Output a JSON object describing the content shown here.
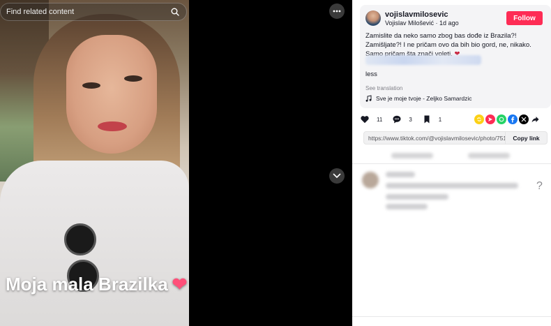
{
  "search": {
    "placeholder": "Find related content",
    "icon": "search-icon"
  },
  "photo": {
    "caption_text": "Moja mala Brazilka",
    "caption_emoji": "❤"
  },
  "post": {
    "username": "vojislavmilosevic",
    "display_name": "Vojislav Milošević",
    "time_ago": "1d ago",
    "follow_label": "Follow",
    "description": "Zamislite da neko samo zbog bas dođe iz Brazila?! Zamišljate?! I ne pričam ovo da bih bio gord, ne, nikako. Samo pričam šta znači voleti.",
    "description_emoji": "❤",
    "less_label": "less",
    "see_translation": "See translation",
    "music": "Sve je moje tvoje - Zeljko Samardzic"
  },
  "actions": {
    "likes": "11",
    "comments": "3",
    "saves": "1"
  },
  "share_icons": [
    {
      "name": "repost-icon",
      "color": "#fcd116"
    },
    {
      "name": "send-icon",
      "color": "#fe2c55"
    },
    {
      "name": "whatsapp-icon",
      "color": "#25d366"
    },
    {
      "name": "facebook-icon",
      "color": "#1877f2"
    },
    {
      "name": "x-icon",
      "color": "#000000"
    },
    {
      "name": "share-arrow-icon",
      "color": "#161823"
    }
  ],
  "link": {
    "url": "https://www.tiktok.com/@vojislavmilosevic/photo/7513...",
    "copy_label": "Copy link"
  },
  "colors": {
    "accent": "#fe2c55",
    "panel_bg": "#f4f4f6"
  }
}
